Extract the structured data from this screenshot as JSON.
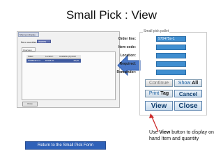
{
  "slide": {
    "title": "Small Pick : View"
  },
  "left_window": {
    "tab_label": "Shipment display",
    "item_number_label": "Item number:",
    "item_number_value": "IN98251",
    "overview_tab": "Overview",
    "columns": [
      "Pallet",
      "Location",
      "Available physical"
    ],
    "rows": [
      {
        "pallet": "PS8894P-8-2",
        "location": "81538-01",
        "available": "28,00"
      }
    ],
    "close_label": "Close"
  },
  "right_panel": {
    "group_title": "Small pick pallet",
    "fields": [
      {
        "label": "Order line:",
        "value": "970475s-1"
      },
      {
        "label": "Item code:",
        "value": ""
      },
      {
        "label": "Location:",
        "value": ""
      },
      {
        "label": "Required:",
        "value": ""
      },
      {
        "label": "Remainder:",
        "value": ""
      }
    ],
    "buttons": {
      "continue": "Continue",
      "show_all_prefix": "Show",
      "show_all_bold": "All",
      "print_tag_prefix": "Print",
      "print_tag_bold": "Tag",
      "cancel": "Cancel",
      "view": "View",
      "close": "Close"
    }
  },
  "annotation": {
    "text_before": "Use",
    "bold": "View",
    "text_after": "button to display on hand Item and quantity"
  },
  "return_link": "Return to the Small Pick Form",
  "colors": {
    "field_blue": "#3f8ed0",
    "arrow_blue": "#4a78c8",
    "return_blue": "#2f61b8",
    "pointer_red": "#cc2a2a"
  }
}
